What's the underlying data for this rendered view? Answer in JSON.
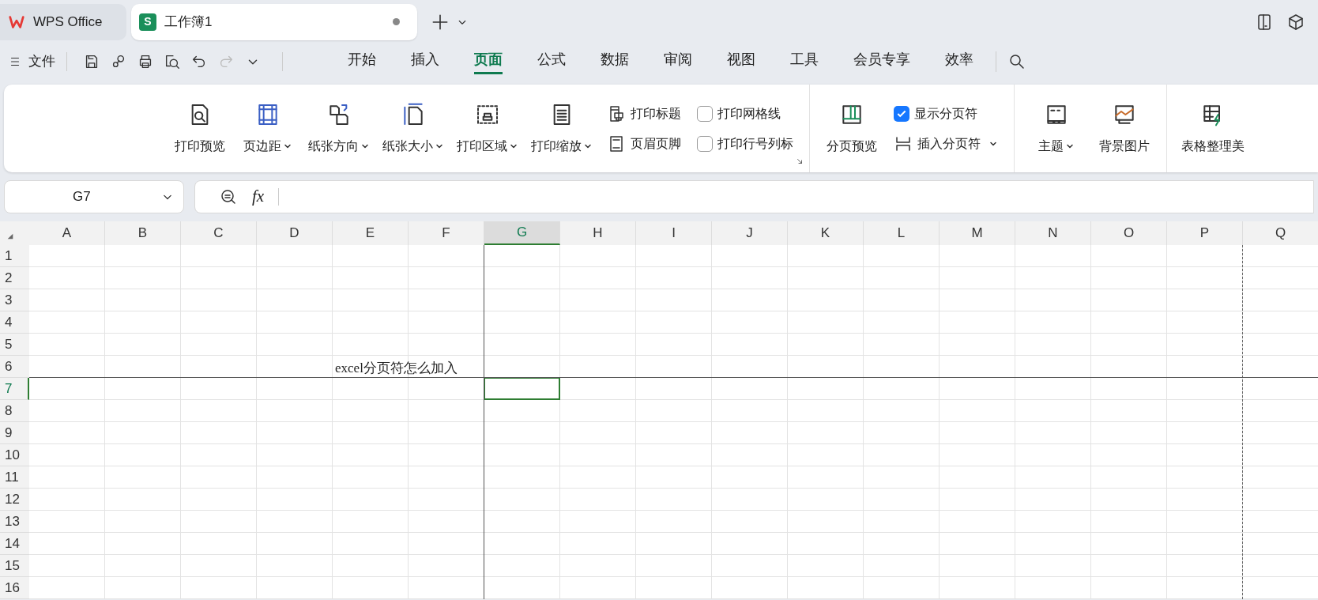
{
  "app_tabs": [
    {
      "label": "WPS Office",
      "kind": "home",
      "selected": false
    },
    {
      "label": "工作簿1",
      "kind": "sheet",
      "badge": "S",
      "selected": true,
      "modified": true
    }
  ],
  "menu": {
    "file": "文件",
    "tabs": [
      {
        "label": "开始",
        "selected": false
      },
      {
        "label": "插入",
        "selected": false
      },
      {
        "label": "页面",
        "selected": true
      },
      {
        "label": "公式",
        "selected": false
      },
      {
        "label": "数据",
        "selected": false
      },
      {
        "label": "审阅",
        "selected": false
      },
      {
        "label": "视图",
        "selected": false
      },
      {
        "label": "工具",
        "selected": false
      },
      {
        "label": "会员专享",
        "selected": false
      },
      {
        "label": "效率",
        "selected": false
      }
    ]
  },
  "ribbon": [
    {
      "items": [
        {
          "kind": "large",
          "label": "打印预览",
          "dropdown": false
        },
        {
          "kind": "large",
          "label": "页边距",
          "dropdown": true
        },
        {
          "kind": "large",
          "label": "纸张方向",
          "dropdown": true
        },
        {
          "kind": "large",
          "label": "纸张大小",
          "dropdown": true
        },
        {
          "kind": "large",
          "label": "打印区域",
          "dropdown": true
        },
        {
          "kind": "large",
          "label": "打印缩放",
          "dropdown": true
        },
        {
          "kind": "small",
          "label": "打印标题",
          "dropdown": false
        },
        {
          "kind": "small",
          "label": "页眉页脚",
          "dropdown": false
        },
        {
          "kind": "check",
          "label": "打印网格线",
          "checked": false
        },
        {
          "kind": "check",
          "label": "打印行号列标",
          "checked": false
        }
      ],
      "launcher": true
    },
    {
      "items": [
        {
          "kind": "large",
          "label": "分页预览",
          "dropdown": false
        },
        {
          "kind": "check",
          "label": "显示分页符",
          "checked": true
        },
        {
          "kind": "small",
          "label": "插入分页符",
          "dropdown": true
        }
      ]
    },
    {
      "items": [
        {
          "kind": "large",
          "label": "主题",
          "dropdown": true
        },
        {
          "kind": "large",
          "label": "背景图片",
          "dropdown": false
        }
      ]
    },
    {
      "items": [
        {
          "kind": "large",
          "label": "表格整理美",
          "dropdown": false
        }
      ]
    }
  ],
  "name_box": "G7",
  "fx_label": "fx",
  "sheet": {
    "columns": [
      {
        "label": "A",
        "selected": false,
        "manual_break_after": false,
        "auto_break_after": false
      },
      {
        "label": "B",
        "selected": false,
        "manual_break_after": false,
        "auto_break_after": false
      },
      {
        "label": "C",
        "selected": false,
        "manual_break_after": false,
        "auto_break_after": false
      },
      {
        "label": "D",
        "selected": false,
        "manual_break_after": false,
        "auto_break_after": false
      },
      {
        "label": "E",
        "selected": false,
        "manual_break_after": false,
        "auto_break_after": false
      },
      {
        "label": "F",
        "selected": false,
        "manual_break_after": true,
        "auto_break_after": false
      },
      {
        "label": "G",
        "selected": true,
        "manual_break_after": false,
        "auto_break_after": false
      },
      {
        "label": "H",
        "selected": false,
        "manual_break_after": false,
        "auto_break_after": false
      },
      {
        "label": "I",
        "selected": false,
        "manual_break_after": false,
        "auto_break_after": false
      },
      {
        "label": "J",
        "selected": false,
        "manual_break_after": false,
        "auto_break_after": false
      },
      {
        "label": "K",
        "selected": false,
        "manual_break_after": false,
        "auto_break_after": false
      },
      {
        "label": "L",
        "selected": false,
        "manual_break_after": false,
        "auto_break_after": false
      },
      {
        "label": "M",
        "selected": false,
        "manual_break_after": false,
        "auto_break_after": false
      },
      {
        "label": "N",
        "selected": false,
        "manual_break_after": false,
        "auto_break_after": false
      },
      {
        "label": "O",
        "selected": false,
        "manual_break_after": false,
        "auto_break_after": false
      },
      {
        "label": "P",
        "selected": false,
        "manual_break_after": false,
        "auto_break_after": true
      },
      {
        "label": "Q",
        "selected": false,
        "manual_break_after": false,
        "auto_break_after": false
      }
    ],
    "rows": [
      {
        "label": "1",
        "selected": false,
        "manual_break_after": false
      },
      {
        "label": "2",
        "selected": false,
        "manual_break_after": false
      },
      {
        "label": "3",
        "selected": false,
        "manual_break_after": false
      },
      {
        "label": "4",
        "selected": false,
        "manual_break_after": false
      },
      {
        "label": "5",
        "selected": false,
        "manual_break_after": false
      },
      {
        "label": "6",
        "selected": false,
        "manual_break_after": true,
        "cells": [
          {
            "kind": "blank"
          },
          {
            "kind": "blank"
          },
          {
            "kind": "blank"
          },
          {
            "kind": "blank"
          },
          {
            "kind": "text",
            "text": "excel分页符怎么加入"
          }
        ]
      },
      {
        "label": "7",
        "selected": true,
        "manual_break_after": false
      },
      {
        "label": "8",
        "selected": false,
        "manual_break_after": false
      },
      {
        "label": "9",
        "selected": false,
        "manual_break_after": false
      },
      {
        "label": "10",
        "selected": false,
        "manual_break_after": false
      },
      {
        "label": "11",
        "selected": false,
        "manual_break_after": false
      },
      {
        "label": "12",
        "selected": false,
        "manual_break_after": false
      },
      {
        "label": "13",
        "selected": false,
        "manual_break_after": false
      },
      {
        "label": "14",
        "selected": false,
        "manual_break_after": false
      },
      {
        "label": "15",
        "selected": false,
        "manual_break_after": false
      },
      {
        "label": "16",
        "selected": false,
        "manual_break_after": false
      }
    ]
  }
}
